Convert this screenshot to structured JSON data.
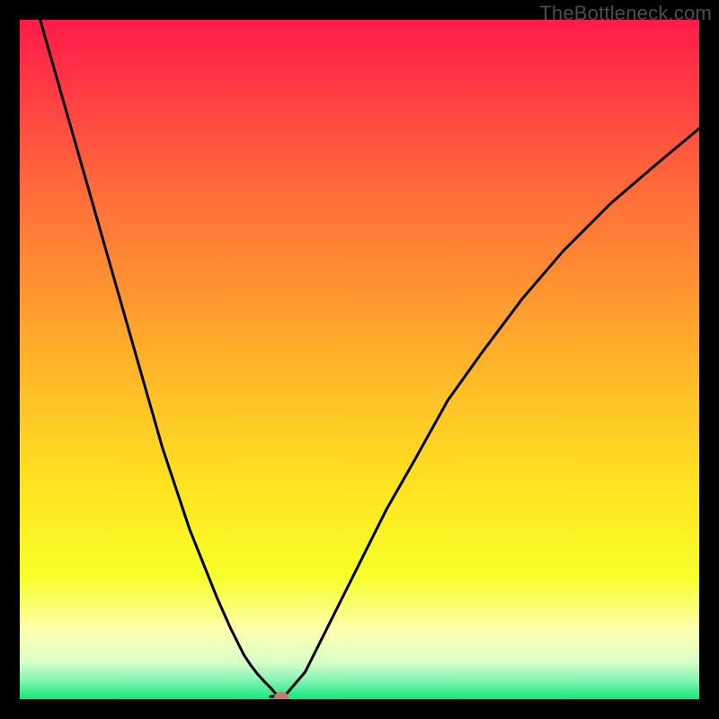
{
  "watermark": {
    "text": "TheBottleneck.com"
  },
  "chart_data": {
    "type": "line",
    "title": "",
    "xlabel": "",
    "ylabel": "",
    "xlim": [
      0,
      100
    ],
    "ylim": [
      0,
      100
    ],
    "x": [
      3,
      5,
      7,
      9,
      11,
      13,
      15,
      17,
      19,
      21,
      23,
      25,
      27,
      29,
      31,
      33,
      34,
      35,
      36,
      37,
      37.5,
      38,
      38.5,
      39,
      42,
      44,
      47,
      50,
      54,
      58,
      63,
      68,
      74,
      80,
      87,
      94,
      100
    ],
    "values": [
      100,
      93,
      86,
      79,
      72,
      65,
      58,
      51,
      44,
      37,
      31,
      25,
      20,
      15,
      10.5,
      6.5,
      5,
      3.7,
      2.6,
      1.6,
      1.0,
      0.5,
      0.2,
      0.5,
      4,
      8,
      14,
      20,
      28,
      35,
      44,
      51,
      59,
      66,
      73,
      79,
      84
    ],
    "notch_x": 38,
    "marker": {
      "x": 38.5,
      "y": 0.3
    },
    "gradient_stops": [
      {
        "offset": 0.0,
        "color": "#ff1a4b"
      },
      {
        "offset": 0.1,
        "color": "#ff3a44"
      },
      {
        "offset": 0.25,
        "color": "#ff6b3a"
      },
      {
        "offset": 0.4,
        "color": "#ff9530"
      },
      {
        "offset": 0.55,
        "color": "#ffc027"
      },
      {
        "offset": 0.7,
        "color": "#ffe61f"
      },
      {
        "offset": 0.82,
        "color": "#f6ff2a"
      },
      {
        "offset": 0.9,
        "color": "#fdffb0"
      },
      {
        "offset": 0.945,
        "color": "#d8ffc8"
      },
      {
        "offset": 0.97,
        "color": "#8cf5b8"
      },
      {
        "offset": 1.0,
        "color": "#10e878"
      }
    ]
  }
}
